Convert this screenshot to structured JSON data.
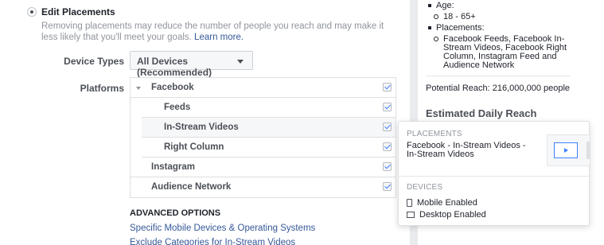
{
  "edit_placements": {
    "title": "Edit Placements",
    "description": "Removing placements may reduce the number of people you reach and may make it less likely that you'll meet your goals.",
    "learn_more": "Learn more."
  },
  "device_types": {
    "label": "Device Types",
    "selected": "All Devices (Recommended)"
  },
  "platforms": {
    "label": "Platforms",
    "rows": [
      {
        "label": "Facebook",
        "checked": true
      },
      {
        "label": "Feeds",
        "checked": true
      },
      {
        "label": "In-Stream Videos",
        "checked": true
      },
      {
        "label": "Right Column",
        "checked": true
      },
      {
        "label": "Instagram",
        "checked": true
      },
      {
        "label": "Audience Network",
        "checked": true
      }
    ]
  },
  "advanced": {
    "title": "ADVANCED OPTIONS",
    "links": [
      "Specific Mobile Devices & Operating Systems",
      "Exclude Categories for In-Stream Videos"
    ]
  },
  "summary": {
    "age_label": "Age:",
    "age_value": "18 - 65+",
    "placements_label": "Placements:",
    "placements_value_lines": [
      "Facebook Feeds, Facebook In-",
      "Stream Videos, Facebook Right",
      "Column, Instagram Feed and",
      "Audience Network"
    ],
    "potential_reach": "Potential Reach: 216,000,000 people",
    "estimated_daily_reach": "Estimated Daily Reach"
  },
  "popup": {
    "placements_title": "PLACEMENTS",
    "placement_text": "Facebook - In-Stream Videos - In-Stream Videos",
    "devices_title": "DEVICES",
    "mobile": "Mobile Enabled",
    "desktop": "Desktop Enabled"
  },
  "colors": {
    "accent": "#4080ff",
    "link": "#365899",
    "page_bg": "#e9ebee"
  }
}
